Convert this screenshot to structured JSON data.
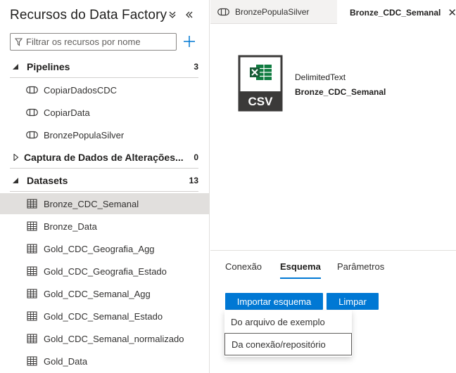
{
  "sidebar": {
    "title": "Recursos do Data Factory",
    "filter_placeholder": "Filtrar os recursos por nome",
    "groups": {
      "pipelines": {
        "label": "Pipelines",
        "count": "3",
        "expanded": true,
        "items": [
          {
            "label": "CopiarDadosCDC",
            "icon": "pipeline-icon"
          },
          {
            "label": "CopiarData",
            "icon": "pipeline-icon"
          },
          {
            "label": "BronzePopulaSilver",
            "icon": "pipeline-icon"
          }
        ]
      },
      "change_capture": {
        "label": "Captura de Dados de Alterações...",
        "count": "0",
        "expanded": false
      },
      "datasets": {
        "label": "Datasets",
        "count": "13",
        "expanded": true,
        "items": [
          {
            "label": "Bronze_CDC_Semanal",
            "icon": "table-icon",
            "selected": true
          },
          {
            "label": "Bronze_Data",
            "icon": "table-icon"
          },
          {
            "label": "Gold_CDC_Geografia_Agg",
            "icon": "table-icon"
          },
          {
            "label": "Gold_CDC_Geografia_Estado",
            "icon": "table-icon"
          },
          {
            "label": "Gold_CDC_Semanal_Agg",
            "icon": "table-icon"
          },
          {
            "label": "Gold_CDC_Semanal_Estado",
            "icon": "table-icon"
          },
          {
            "label": "Gold_CDC_Semanal_normalizado",
            "icon": "table-icon"
          },
          {
            "label": "Gold_Data",
            "icon": "table-icon"
          }
        ]
      }
    }
  },
  "tabs": [
    {
      "label": "BronzePopulaSilver",
      "icon": "pipeline-icon",
      "active": false
    },
    {
      "label": "Bronze_CDC_Semanal",
      "icon": "table-icon",
      "active": true
    }
  ],
  "dataset": {
    "type": "DelimitedText",
    "name": "Bronze_CDC_Semanal",
    "icon_text": "CSV"
  },
  "properties": {
    "tabs": [
      {
        "label": "Conexão",
        "active": false
      },
      {
        "label": "Esquema",
        "active": true
      },
      {
        "label": "Parâmetros",
        "active": false
      }
    ],
    "import_button": "Importar esquema",
    "clear_button": "Limpar",
    "import_menu": [
      {
        "label": "Do arquivo de exemplo"
      },
      {
        "label": "Da conexão/repositório"
      }
    ]
  },
  "colors": {
    "accent": "#0078d4",
    "selected_row": "#e1dfdd",
    "excel_green": "#107c41",
    "icon_dark": "#3b3a39"
  }
}
